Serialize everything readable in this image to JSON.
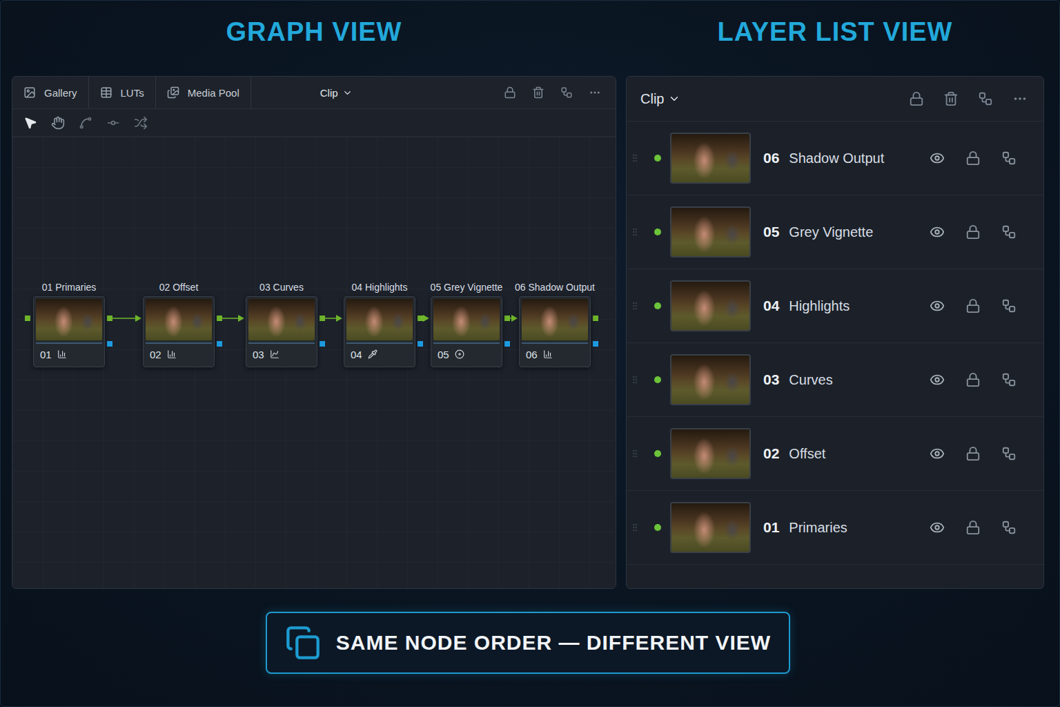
{
  "graph_view": {
    "title": "GRAPH VIEW",
    "toolbar": {
      "tabs": [
        "Gallery",
        "LUTs",
        "Media Pool"
      ],
      "dropdown": "Clip"
    },
    "nodes": [
      {
        "label": "01 Primaries",
        "number": "01",
        "kind": "primaries"
      },
      {
        "label": "02 Offset",
        "number": "02",
        "kind": "primaries"
      },
      {
        "label": "03 Curves",
        "number": "03",
        "kind": "curves"
      },
      {
        "label": "04 Highlights",
        "number": "04",
        "kind": "qualifier"
      },
      {
        "label": "05 Grey Vignette",
        "number": "05",
        "kind": "window"
      },
      {
        "label": "06 Shadow Output",
        "number": "06",
        "kind": "primaries"
      }
    ]
  },
  "layer_list_view": {
    "title": "LAYER LIST VIEW",
    "dropdown": "Clip",
    "layers": [
      {
        "number": "06",
        "name": "Shadow Output",
        "enabled": true
      },
      {
        "number": "05",
        "name": "Grey Vignette",
        "enabled": true
      },
      {
        "number": "04",
        "name": "Highlights",
        "enabled": true
      },
      {
        "number": "03",
        "name": "Curves",
        "enabled": true
      },
      {
        "number": "02",
        "name": "Offset",
        "enabled": true
      },
      {
        "number": "01",
        "name": "Primaries",
        "enabled": true
      }
    ]
  },
  "footer": {
    "label": "SAME NODE ORDER — DIFFERENT VIEW"
  }
}
